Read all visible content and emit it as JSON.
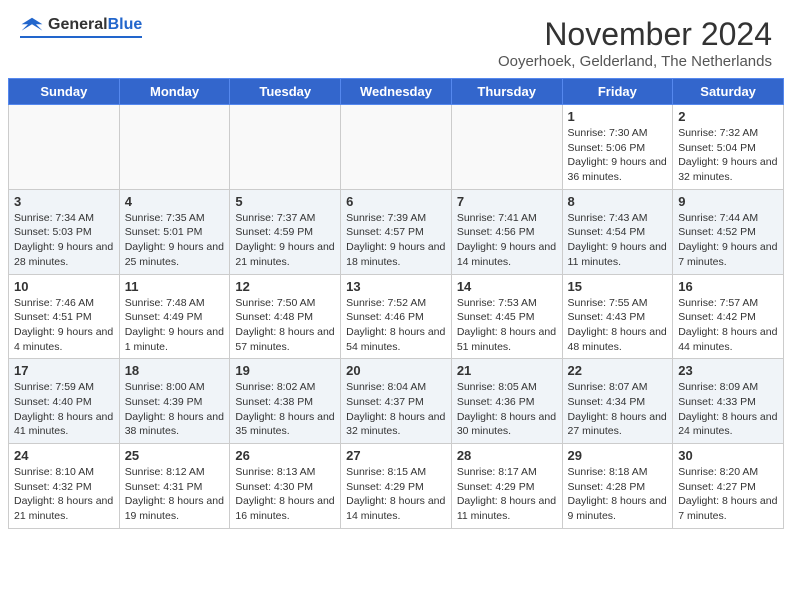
{
  "logo": {
    "general": "General",
    "blue": "Blue"
  },
  "title": "November 2024",
  "location": "Ooyerhoek, Gelderland, The Netherlands",
  "days_of_week": [
    "Sunday",
    "Monday",
    "Tuesday",
    "Wednesday",
    "Thursday",
    "Friday",
    "Saturday"
  ],
  "weeks": [
    [
      {
        "day": "",
        "info": ""
      },
      {
        "day": "",
        "info": ""
      },
      {
        "day": "",
        "info": ""
      },
      {
        "day": "",
        "info": ""
      },
      {
        "day": "",
        "info": ""
      },
      {
        "day": "1",
        "info": "Sunrise: 7:30 AM\nSunset: 5:06 PM\nDaylight: 9 hours and 36 minutes."
      },
      {
        "day": "2",
        "info": "Sunrise: 7:32 AM\nSunset: 5:04 PM\nDaylight: 9 hours and 32 minutes."
      }
    ],
    [
      {
        "day": "3",
        "info": "Sunrise: 7:34 AM\nSunset: 5:03 PM\nDaylight: 9 hours and 28 minutes."
      },
      {
        "day": "4",
        "info": "Sunrise: 7:35 AM\nSunset: 5:01 PM\nDaylight: 9 hours and 25 minutes."
      },
      {
        "day": "5",
        "info": "Sunrise: 7:37 AM\nSunset: 4:59 PM\nDaylight: 9 hours and 21 minutes."
      },
      {
        "day": "6",
        "info": "Sunrise: 7:39 AM\nSunset: 4:57 PM\nDaylight: 9 hours and 18 minutes."
      },
      {
        "day": "7",
        "info": "Sunrise: 7:41 AM\nSunset: 4:56 PM\nDaylight: 9 hours and 14 minutes."
      },
      {
        "day": "8",
        "info": "Sunrise: 7:43 AM\nSunset: 4:54 PM\nDaylight: 9 hours and 11 minutes."
      },
      {
        "day": "9",
        "info": "Sunrise: 7:44 AM\nSunset: 4:52 PM\nDaylight: 9 hours and 7 minutes."
      }
    ],
    [
      {
        "day": "10",
        "info": "Sunrise: 7:46 AM\nSunset: 4:51 PM\nDaylight: 9 hours and 4 minutes."
      },
      {
        "day": "11",
        "info": "Sunrise: 7:48 AM\nSunset: 4:49 PM\nDaylight: 9 hours and 1 minute."
      },
      {
        "day": "12",
        "info": "Sunrise: 7:50 AM\nSunset: 4:48 PM\nDaylight: 8 hours and 57 minutes."
      },
      {
        "day": "13",
        "info": "Sunrise: 7:52 AM\nSunset: 4:46 PM\nDaylight: 8 hours and 54 minutes."
      },
      {
        "day": "14",
        "info": "Sunrise: 7:53 AM\nSunset: 4:45 PM\nDaylight: 8 hours and 51 minutes."
      },
      {
        "day": "15",
        "info": "Sunrise: 7:55 AM\nSunset: 4:43 PM\nDaylight: 8 hours and 48 minutes."
      },
      {
        "day": "16",
        "info": "Sunrise: 7:57 AM\nSunset: 4:42 PM\nDaylight: 8 hours and 44 minutes."
      }
    ],
    [
      {
        "day": "17",
        "info": "Sunrise: 7:59 AM\nSunset: 4:40 PM\nDaylight: 8 hours and 41 minutes."
      },
      {
        "day": "18",
        "info": "Sunrise: 8:00 AM\nSunset: 4:39 PM\nDaylight: 8 hours and 38 minutes."
      },
      {
        "day": "19",
        "info": "Sunrise: 8:02 AM\nSunset: 4:38 PM\nDaylight: 8 hours and 35 minutes."
      },
      {
        "day": "20",
        "info": "Sunrise: 8:04 AM\nSunset: 4:37 PM\nDaylight: 8 hours and 32 minutes."
      },
      {
        "day": "21",
        "info": "Sunrise: 8:05 AM\nSunset: 4:36 PM\nDaylight: 8 hours and 30 minutes."
      },
      {
        "day": "22",
        "info": "Sunrise: 8:07 AM\nSunset: 4:34 PM\nDaylight: 8 hours and 27 minutes."
      },
      {
        "day": "23",
        "info": "Sunrise: 8:09 AM\nSunset: 4:33 PM\nDaylight: 8 hours and 24 minutes."
      }
    ],
    [
      {
        "day": "24",
        "info": "Sunrise: 8:10 AM\nSunset: 4:32 PM\nDaylight: 8 hours and 21 minutes."
      },
      {
        "day": "25",
        "info": "Sunrise: 8:12 AM\nSunset: 4:31 PM\nDaylight: 8 hours and 19 minutes."
      },
      {
        "day": "26",
        "info": "Sunrise: 8:13 AM\nSunset: 4:30 PM\nDaylight: 8 hours and 16 minutes."
      },
      {
        "day": "27",
        "info": "Sunrise: 8:15 AM\nSunset: 4:29 PM\nDaylight: 8 hours and 14 minutes."
      },
      {
        "day": "28",
        "info": "Sunrise: 8:17 AM\nSunset: 4:29 PM\nDaylight: 8 hours and 11 minutes."
      },
      {
        "day": "29",
        "info": "Sunrise: 8:18 AM\nSunset: 4:28 PM\nDaylight: 8 hours and 9 minutes."
      },
      {
        "day": "30",
        "info": "Sunrise: 8:20 AM\nSunset: 4:27 PM\nDaylight: 8 hours and 7 minutes."
      }
    ]
  ]
}
